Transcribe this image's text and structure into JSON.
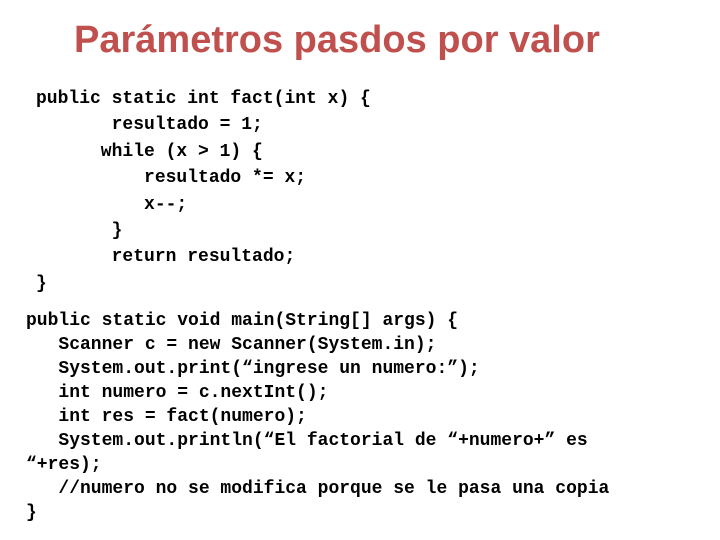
{
  "slide": {
    "title": "Parámetros pasdos por valor",
    "title_color": "#C0504D"
  },
  "code_blocks": {
    "fact_method": {
      "lines": [
        "public static int fact(int x) {",
        "       resultado = 1;",
        "      while (x > 1) {",
        "          resultado *= x;",
        "          x--;",
        "       }",
        "       return resultado;",
        "}"
      ]
    },
    "main_method": {
      "lines": [
        "public static void main(String[] args) {",
        "   Scanner c = new Scanner(System.in);",
        "   System.out.print(“ingrese un numero:”);",
        "   int numero = c.nextInt();",
        "   int res = fact(numero);",
        "   System.out.println(“El factorial de “+numero+” es",
        "“+res);",
        "   //numero no se modifica porque se le pasa una copia",
        "}"
      ]
    }
  }
}
